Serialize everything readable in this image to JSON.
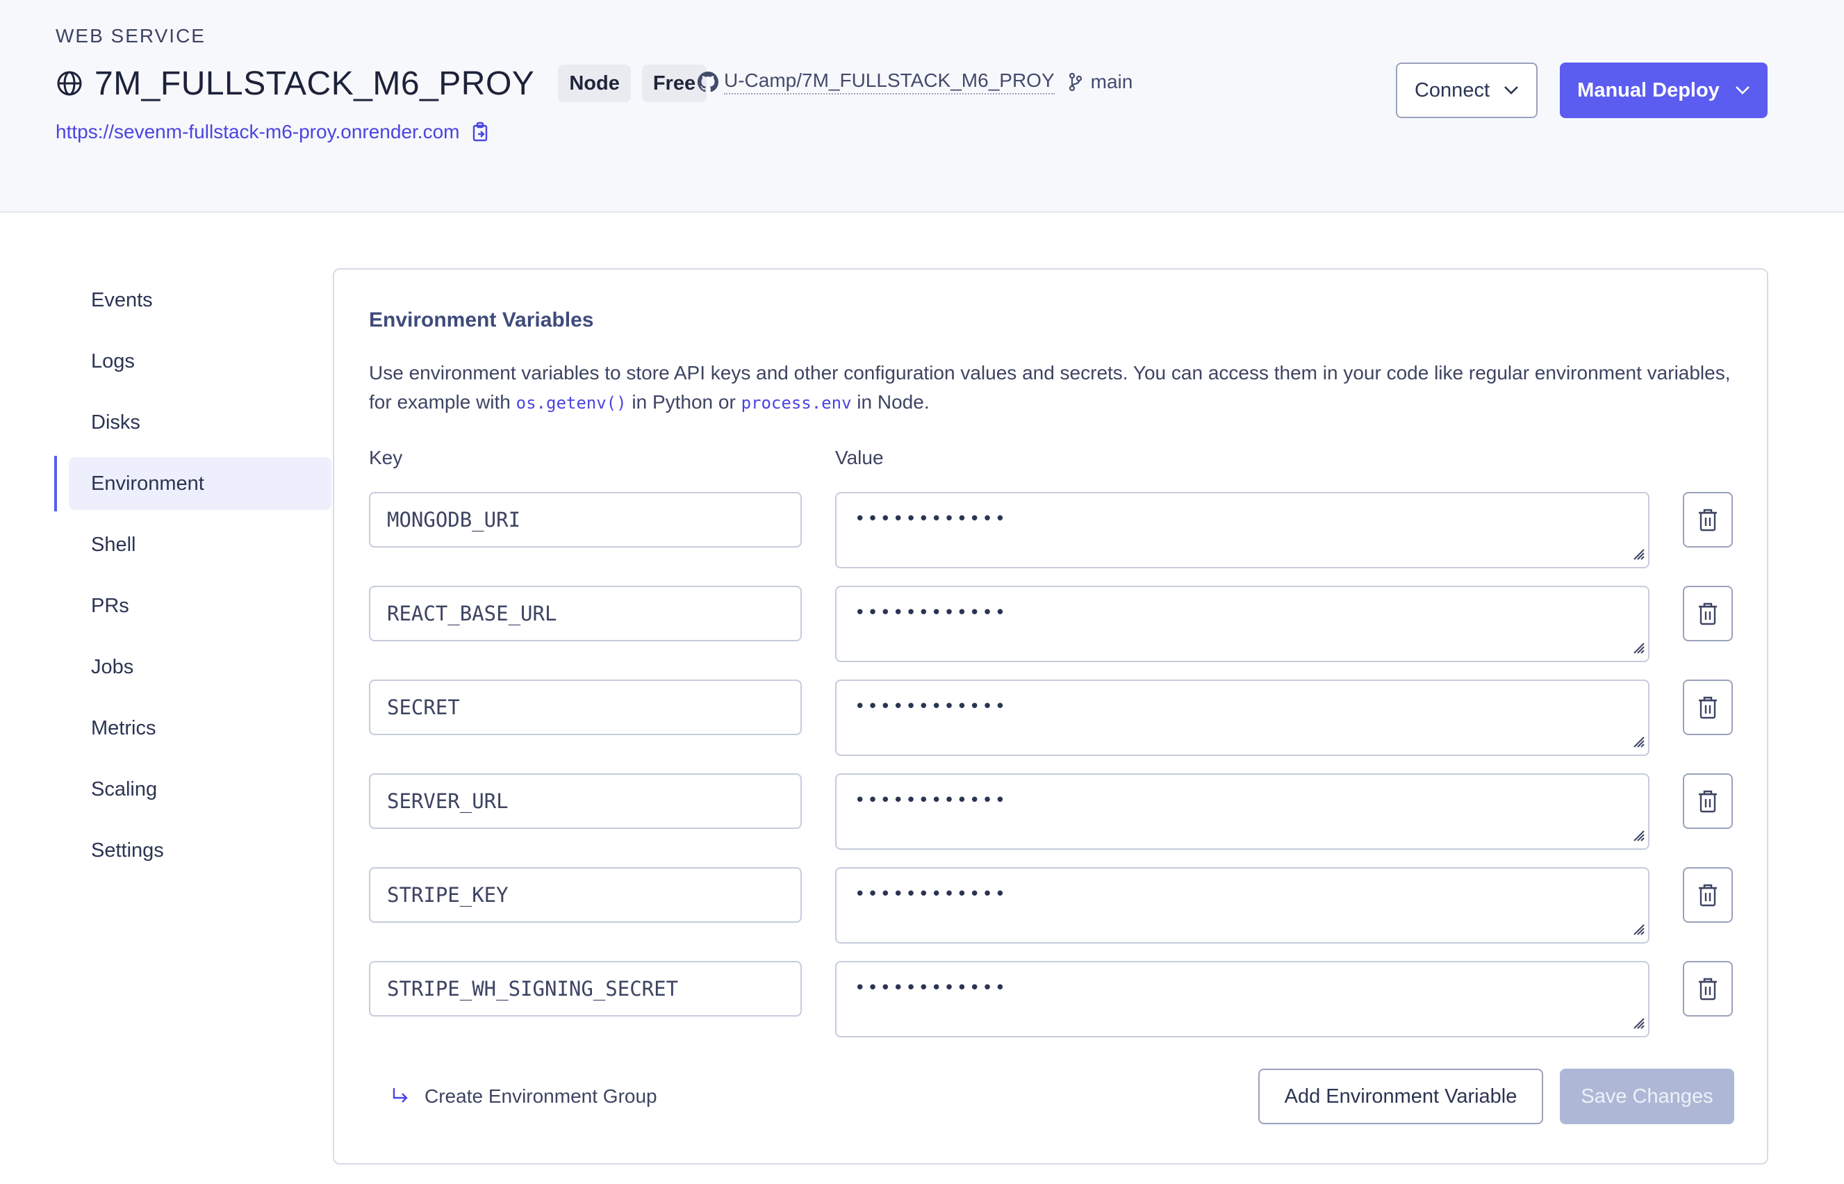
{
  "header": {
    "service_type": "WEB SERVICE",
    "service_name": "7M_FULLSTACK_M6_PROY",
    "tags": [
      "Node",
      "Free"
    ],
    "repo": "U-Camp/7M_FULLSTACK_M6_PROY",
    "branch": "main",
    "url": "https://sevenm-fullstack-m6-proy.onrender.com",
    "connect_label": "Connect",
    "deploy_label": "Manual Deploy"
  },
  "sidebar": {
    "items": [
      {
        "label": "Events"
      },
      {
        "label": "Logs"
      },
      {
        "label": "Disks"
      },
      {
        "label": "Environment",
        "active": true
      },
      {
        "label": "Shell"
      },
      {
        "label": "PRs"
      },
      {
        "label": "Jobs"
      },
      {
        "label": "Metrics"
      },
      {
        "label": "Scaling"
      },
      {
        "label": "Settings"
      }
    ]
  },
  "env": {
    "title": "Environment Variables",
    "desc_part1": "Use environment variables to store API keys and other configuration values and secrets. You can access them in your code like regular environment variables, for example with ",
    "desc_code1": "os.getenv()",
    "desc_part2": " in Python or ",
    "desc_code2": "process.env",
    "desc_part3": " in Node.",
    "key_header": "Key",
    "value_header": "Value",
    "masked_value": "••••••••••••",
    "rows": [
      {
        "key": "MONGODB_URI"
      },
      {
        "key": "REACT_BASE_URL"
      },
      {
        "key": "SECRET"
      },
      {
        "key": "SERVER_URL"
      },
      {
        "key": "STRIPE_KEY"
      },
      {
        "key": "STRIPE_WH_SIGNING_SECRET"
      }
    ],
    "create_group_label": "Create Environment Group",
    "add_label": "Add Environment Variable",
    "save_label": "Save Changes"
  },
  "colors": {
    "accent": "#5b5cf0",
    "link": "#4a44e0",
    "save_disabled": "#aeb8d6"
  }
}
